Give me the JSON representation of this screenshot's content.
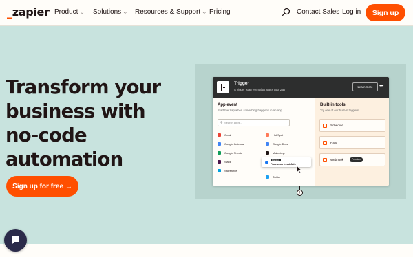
{
  "header": {
    "logo": {
      "prefix": "_",
      "text": "zapier"
    },
    "nav": [
      {
        "label": "Product"
      },
      {
        "label": "Solutions"
      },
      {
        "label": "Resources & Support"
      },
      {
        "label": "Pricing"
      }
    ],
    "contact_sales": "Contact Sales",
    "log_in": "Log in",
    "sign_up": "Sign up"
  },
  "hero": {
    "headline": [
      "Transform your",
      "business with",
      "no-code",
      "automation"
    ],
    "cta": "Sign up for free →"
  },
  "demo": {
    "trigger": {
      "title": "Trigger",
      "subtitle": "A trigger is an event that starts your Zap",
      "learn_more": "Learn more",
      "menu_glyph": "•••"
    },
    "app_event": {
      "title": "App event",
      "subtitle": "Start the Zap when something happens in an app",
      "search_placeholder": "Search apps...",
      "apps_left": [
        {
          "name": "Gmail",
          "color": "#ea4335"
        },
        {
          "name": "Google Calendar",
          "color": "#4285f4"
        },
        {
          "name": "Google Sheets",
          "color": "#0f9d58"
        },
        {
          "name": "Slack",
          "color": "#4a154b"
        },
        {
          "name": "Salesforce",
          "color": "#00a1e0"
        }
      ],
      "apps_right": [
        {
          "name": "HubSpot",
          "color": "#ff7a59"
        },
        {
          "name": "Google Docs",
          "color": "#4285f4"
        },
        {
          "name": "Mailchimp",
          "color": "#201515"
        },
        {
          "name": "Twitter",
          "color": "#1da1f2"
        }
      ],
      "highlight": {
        "badge": "Premium",
        "name": "Facebook Lead Ads",
        "color": "#1877f2"
      }
    },
    "built_in": {
      "title": "Built-in tools",
      "subtitle": "Try one of our built-in triggers",
      "tools": [
        {
          "name": "Schedule"
        },
        {
          "name": "RSS"
        },
        {
          "name": "Webhook",
          "badge": "Premium"
        }
      ]
    }
  },
  "colors": {
    "brand": "#ff4f00",
    "hero_background": "#c8e3de",
    "dark": "#201515"
  },
  "icons": {
    "search": "search-icon",
    "chevron": "chevron-down-icon",
    "chat": "chat-icon",
    "pointer": "cursor-icon"
  }
}
